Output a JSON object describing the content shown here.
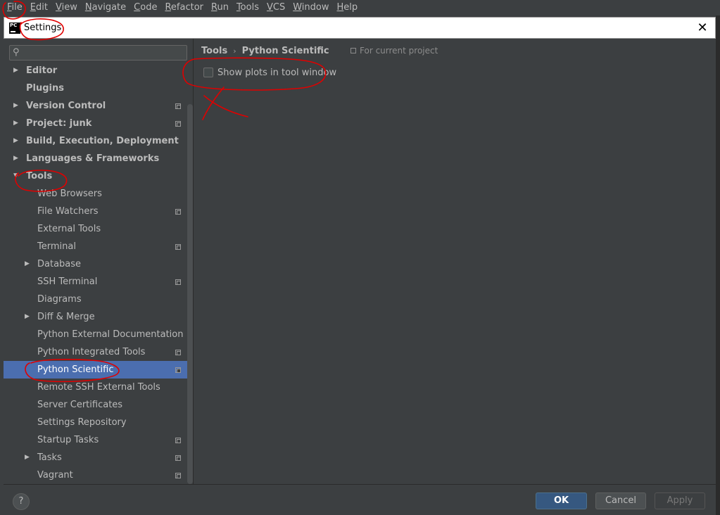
{
  "menubar": {
    "items": [
      {
        "mnemonic": "F",
        "rest": "ile"
      },
      {
        "mnemonic": "E",
        "rest": "dit"
      },
      {
        "mnemonic": "V",
        "rest": "iew"
      },
      {
        "mnemonic": "N",
        "rest": "avigate"
      },
      {
        "mnemonic": "C",
        "rest": "ode"
      },
      {
        "mnemonic": "R",
        "rest": "efactor"
      },
      {
        "mnemonic": "R",
        "rest": "un"
      },
      {
        "mnemonic": "T",
        "rest": "ools"
      },
      {
        "mnemonic": "V",
        "rest": "CS"
      },
      {
        "mnemonic": "W",
        "rest": "indow"
      },
      {
        "mnemonic": "H",
        "rest": "elp"
      }
    ]
  },
  "window": {
    "logo_text": "PC",
    "title": "Settings",
    "close_glyph": "✕"
  },
  "search": {
    "icon_glyph": "⚲",
    "value": "",
    "placeholder": ""
  },
  "tree": [
    {
      "label": "Editor",
      "level": 0,
      "arrow": "▶",
      "bold": true,
      "project_icon": false,
      "selected": false
    },
    {
      "label": "Plugins",
      "level": 0,
      "arrow": "",
      "bold": true,
      "project_icon": false,
      "selected": false
    },
    {
      "label": "Version Control",
      "level": 0,
      "arrow": "▶",
      "bold": true,
      "project_icon": true,
      "selected": false
    },
    {
      "label": "Project: junk",
      "level": 0,
      "arrow": "▶",
      "bold": true,
      "project_icon": true,
      "selected": false
    },
    {
      "label": "Build, Execution, Deployment",
      "level": 0,
      "arrow": "▶",
      "bold": true,
      "project_icon": false,
      "selected": false
    },
    {
      "label": "Languages & Frameworks",
      "level": 0,
      "arrow": "▶",
      "bold": true,
      "project_icon": false,
      "selected": false
    },
    {
      "label": "Tools",
      "level": 0,
      "arrow": "▼",
      "bold": true,
      "project_icon": false,
      "selected": false
    },
    {
      "label": "Web Browsers",
      "level": 1,
      "arrow": "",
      "bold": false,
      "project_icon": false,
      "selected": false
    },
    {
      "label": "File Watchers",
      "level": 1,
      "arrow": "",
      "bold": false,
      "project_icon": true,
      "selected": false
    },
    {
      "label": "External Tools",
      "level": 1,
      "arrow": "",
      "bold": false,
      "project_icon": false,
      "selected": false
    },
    {
      "label": "Terminal",
      "level": 1,
      "arrow": "",
      "bold": false,
      "project_icon": true,
      "selected": false
    },
    {
      "label": "Database",
      "level": 1,
      "arrow": "▶",
      "bold": false,
      "project_icon": false,
      "selected": false
    },
    {
      "label": "SSH Terminal",
      "level": 1,
      "arrow": "",
      "bold": false,
      "project_icon": true,
      "selected": false
    },
    {
      "label": "Diagrams",
      "level": 1,
      "arrow": "",
      "bold": false,
      "project_icon": false,
      "selected": false
    },
    {
      "label": "Diff & Merge",
      "level": 1,
      "arrow": "▶",
      "bold": false,
      "project_icon": false,
      "selected": false
    },
    {
      "label": "Python External Documentation",
      "level": 1,
      "arrow": "",
      "bold": false,
      "project_icon": false,
      "selected": false
    },
    {
      "label": "Python Integrated Tools",
      "level": 1,
      "arrow": "",
      "bold": false,
      "project_icon": true,
      "selected": false
    },
    {
      "label": "Python Scientific",
      "level": 1,
      "arrow": "",
      "bold": false,
      "project_icon": true,
      "selected": true
    },
    {
      "label": "Remote SSH External Tools",
      "level": 1,
      "arrow": "",
      "bold": false,
      "project_icon": false,
      "selected": false
    },
    {
      "label": "Server Certificates",
      "level": 1,
      "arrow": "",
      "bold": false,
      "project_icon": false,
      "selected": false
    },
    {
      "label": "Settings Repository",
      "level": 1,
      "arrow": "",
      "bold": false,
      "project_icon": false,
      "selected": false
    },
    {
      "label": "Startup Tasks",
      "level": 1,
      "arrow": "",
      "bold": false,
      "project_icon": true,
      "selected": false
    },
    {
      "label": "Tasks",
      "level": 1,
      "arrow": "▶",
      "bold": false,
      "project_icon": true,
      "selected": false
    },
    {
      "label": "Vagrant",
      "level": 1,
      "arrow": "",
      "bold": false,
      "project_icon": true,
      "selected": false
    }
  ],
  "content": {
    "breadcrumb": [
      "Tools",
      "Python Scientific"
    ],
    "breadcrumb_sep": "›",
    "for_current_project": "For current project",
    "option_label": "Show plots in tool window",
    "option_checked": false
  },
  "footer": {
    "help": "?",
    "ok": "OK",
    "cancel": "Cancel",
    "apply": "Apply"
  },
  "colors": {
    "background": "#3c3f41",
    "selection": "#4b6eaf",
    "ok_button": "#365880",
    "annotation": "#e00000"
  }
}
